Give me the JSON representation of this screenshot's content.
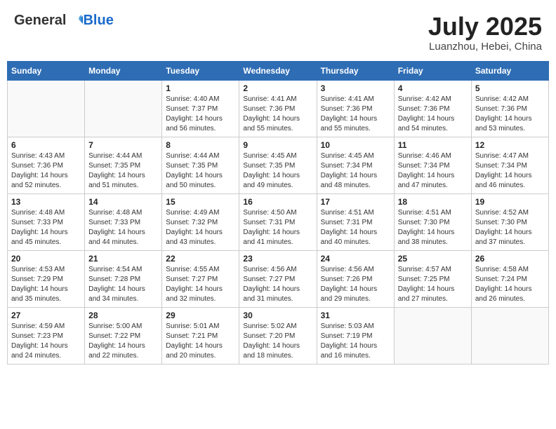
{
  "logo": {
    "general": "General",
    "blue": "Blue"
  },
  "header": {
    "month": "July 2025",
    "location": "Luanzhou, Hebei, China"
  },
  "weekdays": [
    "Sunday",
    "Monday",
    "Tuesday",
    "Wednesday",
    "Thursday",
    "Friday",
    "Saturday"
  ],
  "weeks": [
    [
      {
        "day": "",
        "sunrise": "",
        "sunset": "",
        "daylight": ""
      },
      {
        "day": "",
        "sunrise": "",
        "sunset": "",
        "daylight": ""
      },
      {
        "day": "1",
        "sunrise": "Sunrise: 4:40 AM",
        "sunset": "Sunset: 7:37 PM",
        "daylight": "Daylight: 14 hours and 56 minutes."
      },
      {
        "day": "2",
        "sunrise": "Sunrise: 4:41 AM",
        "sunset": "Sunset: 7:36 PM",
        "daylight": "Daylight: 14 hours and 55 minutes."
      },
      {
        "day": "3",
        "sunrise": "Sunrise: 4:41 AM",
        "sunset": "Sunset: 7:36 PM",
        "daylight": "Daylight: 14 hours and 55 minutes."
      },
      {
        "day": "4",
        "sunrise": "Sunrise: 4:42 AM",
        "sunset": "Sunset: 7:36 PM",
        "daylight": "Daylight: 14 hours and 54 minutes."
      },
      {
        "day": "5",
        "sunrise": "Sunrise: 4:42 AM",
        "sunset": "Sunset: 7:36 PM",
        "daylight": "Daylight: 14 hours and 53 minutes."
      }
    ],
    [
      {
        "day": "6",
        "sunrise": "Sunrise: 4:43 AM",
        "sunset": "Sunset: 7:36 PM",
        "daylight": "Daylight: 14 hours and 52 minutes."
      },
      {
        "day": "7",
        "sunrise": "Sunrise: 4:44 AM",
        "sunset": "Sunset: 7:35 PM",
        "daylight": "Daylight: 14 hours and 51 minutes."
      },
      {
        "day": "8",
        "sunrise": "Sunrise: 4:44 AM",
        "sunset": "Sunset: 7:35 PM",
        "daylight": "Daylight: 14 hours and 50 minutes."
      },
      {
        "day": "9",
        "sunrise": "Sunrise: 4:45 AM",
        "sunset": "Sunset: 7:35 PM",
        "daylight": "Daylight: 14 hours and 49 minutes."
      },
      {
        "day": "10",
        "sunrise": "Sunrise: 4:45 AM",
        "sunset": "Sunset: 7:34 PM",
        "daylight": "Daylight: 14 hours and 48 minutes."
      },
      {
        "day": "11",
        "sunrise": "Sunrise: 4:46 AM",
        "sunset": "Sunset: 7:34 PM",
        "daylight": "Daylight: 14 hours and 47 minutes."
      },
      {
        "day": "12",
        "sunrise": "Sunrise: 4:47 AM",
        "sunset": "Sunset: 7:34 PM",
        "daylight": "Daylight: 14 hours and 46 minutes."
      }
    ],
    [
      {
        "day": "13",
        "sunrise": "Sunrise: 4:48 AM",
        "sunset": "Sunset: 7:33 PM",
        "daylight": "Daylight: 14 hours and 45 minutes."
      },
      {
        "day": "14",
        "sunrise": "Sunrise: 4:48 AM",
        "sunset": "Sunset: 7:33 PM",
        "daylight": "Daylight: 14 hours and 44 minutes."
      },
      {
        "day": "15",
        "sunrise": "Sunrise: 4:49 AM",
        "sunset": "Sunset: 7:32 PM",
        "daylight": "Daylight: 14 hours and 43 minutes."
      },
      {
        "day": "16",
        "sunrise": "Sunrise: 4:50 AM",
        "sunset": "Sunset: 7:31 PM",
        "daylight": "Daylight: 14 hours and 41 minutes."
      },
      {
        "day": "17",
        "sunrise": "Sunrise: 4:51 AM",
        "sunset": "Sunset: 7:31 PM",
        "daylight": "Daylight: 14 hours and 40 minutes."
      },
      {
        "day": "18",
        "sunrise": "Sunrise: 4:51 AM",
        "sunset": "Sunset: 7:30 PM",
        "daylight": "Daylight: 14 hours and 38 minutes."
      },
      {
        "day": "19",
        "sunrise": "Sunrise: 4:52 AM",
        "sunset": "Sunset: 7:30 PM",
        "daylight": "Daylight: 14 hours and 37 minutes."
      }
    ],
    [
      {
        "day": "20",
        "sunrise": "Sunrise: 4:53 AM",
        "sunset": "Sunset: 7:29 PM",
        "daylight": "Daylight: 14 hours and 35 minutes."
      },
      {
        "day": "21",
        "sunrise": "Sunrise: 4:54 AM",
        "sunset": "Sunset: 7:28 PM",
        "daylight": "Daylight: 14 hours and 34 minutes."
      },
      {
        "day": "22",
        "sunrise": "Sunrise: 4:55 AM",
        "sunset": "Sunset: 7:27 PM",
        "daylight": "Daylight: 14 hours and 32 minutes."
      },
      {
        "day": "23",
        "sunrise": "Sunrise: 4:56 AM",
        "sunset": "Sunset: 7:27 PM",
        "daylight": "Daylight: 14 hours and 31 minutes."
      },
      {
        "day": "24",
        "sunrise": "Sunrise: 4:56 AM",
        "sunset": "Sunset: 7:26 PM",
        "daylight": "Daylight: 14 hours and 29 minutes."
      },
      {
        "day": "25",
        "sunrise": "Sunrise: 4:57 AM",
        "sunset": "Sunset: 7:25 PM",
        "daylight": "Daylight: 14 hours and 27 minutes."
      },
      {
        "day": "26",
        "sunrise": "Sunrise: 4:58 AM",
        "sunset": "Sunset: 7:24 PM",
        "daylight": "Daylight: 14 hours and 26 minutes."
      }
    ],
    [
      {
        "day": "27",
        "sunrise": "Sunrise: 4:59 AM",
        "sunset": "Sunset: 7:23 PM",
        "daylight": "Daylight: 14 hours and 24 minutes."
      },
      {
        "day": "28",
        "sunrise": "Sunrise: 5:00 AM",
        "sunset": "Sunset: 7:22 PM",
        "daylight": "Daylight: 14 hours and 22 minutes."
      },
      {
        "day": "29",
        "sunrise": "Sunrise: 5:01 AM",
        "sunset": "Sunset: 7:21 PM",
        "daylight": "Daylight: 14 hours and 20 minutes."
      },
      {
        "day": "30",
        "sunrise": "Sunrise: 5:02 AM",
        "sunset": "Sunset: 7:20 PM",
        "daylight": "Daylight: 14 hours and 18 minutes."
      },
      {
        "day": "31",
        "sunrise": "Sunrise: 5:03 AM",
        "sunset": "Sunset: 7:19 PM",
        "daylight": "Daylight: 14 hours and 16 minutes."
      },
      {
        "day": "",
        "sunrise": "",
        "sunset": "",
        "daylight": ""
      },
      {
        "day": "",
        "sunrise": "",
        "sunset": "",
        "daylight": ""
      }
    ]
  ]
}
